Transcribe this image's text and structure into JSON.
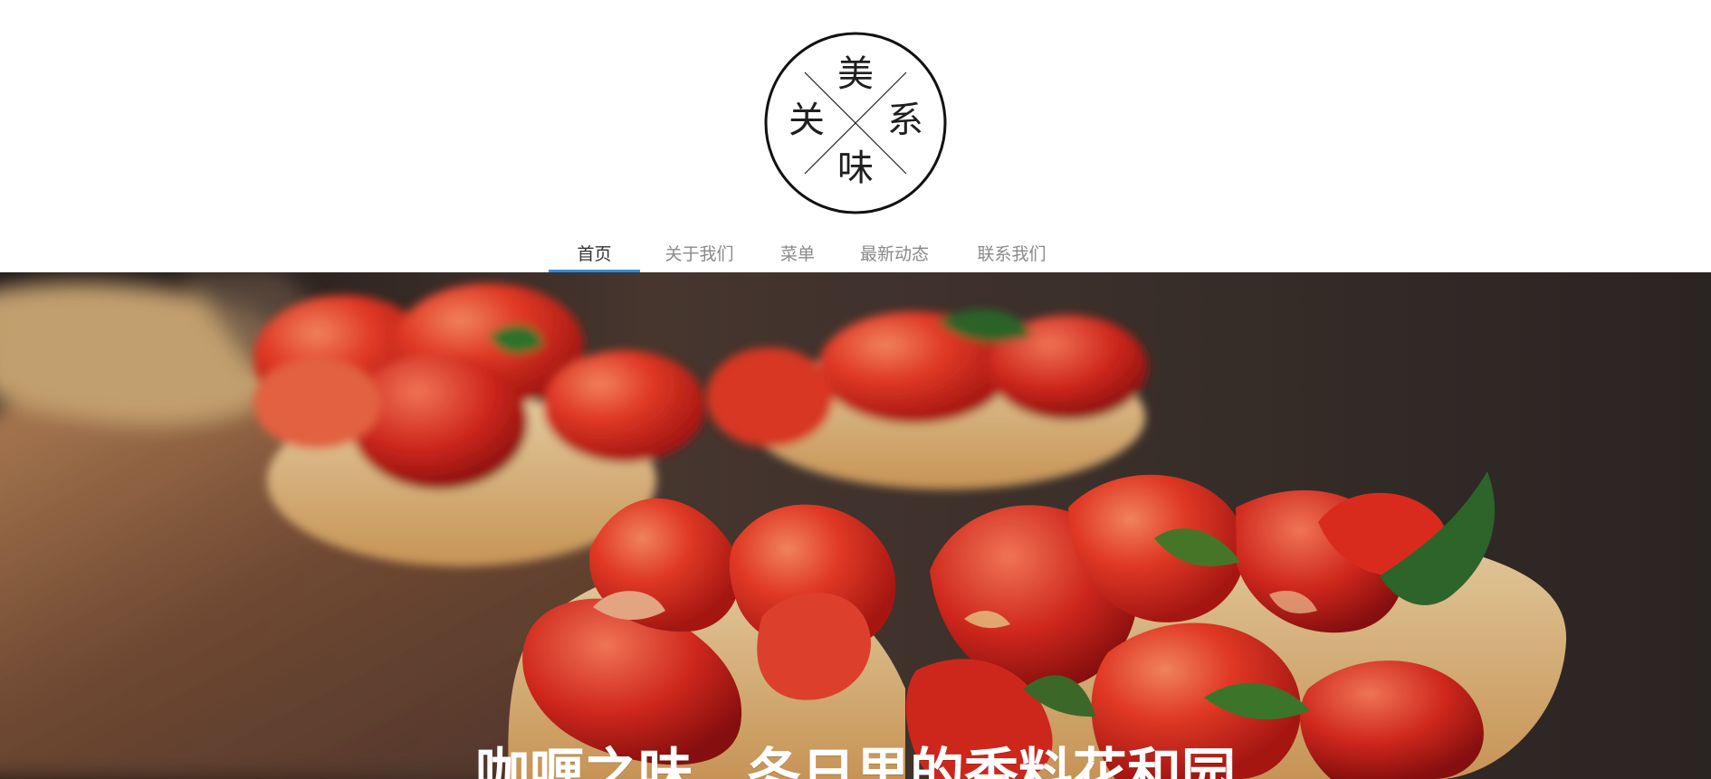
{
  "logo": {
    "characters": {
      "top": "美",
      "left": "关",
      "right": "系",
      "bottom": "味"
    }
  },
  "nav": {
    "items": [
      {
        "label": "首页",
        "active": true
      },
      {
        "label": "关于我们",
        "active": false
      },
      {
        "label": "菜单",
        "active": false
      },
      {
        "label": "最新动态",
        "active": false
      },
      {
        "label": "联系我们",
        "active": false
      }
    ]
  },
  "hero": {
    "title": "咖喱之味，冬日里的香料花和园"
  },
  "colors": {
    "nav_active_underline": "#2f8fe3",
    "nav_text": "#8a8a8a",
    "nav_text_active": "#333333",
    "logo_stroke": "#111111",
    "hero_background": "#3a3331",
    "tomato_red": "#df3023",
    "bread": "#e7c28c",
    "basil": "#2f6b2c"
  }
}
